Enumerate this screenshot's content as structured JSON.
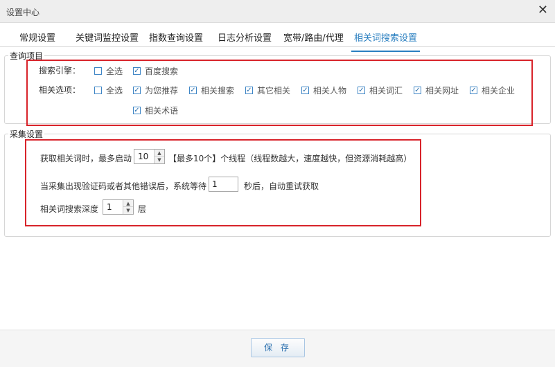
{
  "window": {
    "title": "设置中心",
    "close_icon": "close-icon"
  },
  "tabs": [
    {
      "label": "常规设置"
    },
    {
      "label": "关键词监控设置"
    },
    {
      "label": "指数查询设置"
    },
    {
      "label": "日志分析设置"
    },
    {
      "label": "宽带/路由/代理"
    },
    {
      "label": "相关词搜索设置",
      "active": true
    }
  ],
  "query_section": {
    "legend": "查询项目",
    "engine_label": "搜索引擎：",
    "engines": [
      {
        "label": "全选",
        "checked": false
      },
      {
        "label": "百度搜索",
        "checked": true
      }
    ],
    "options_label": "相关选项：",
    "options": [
      {
        "label": "全选",
        "checked": false
      },
      {
        "label": "为您推荐",
        "checked": true
      },
      {
        "label": "相关搜索",
        "checked": true
      },
      {
        "label": "其它相关",
        "checked": true
      },
      {
        "label": "相关人物",
        "checked": true
      },
      {
        "label": "相关词汇",
        "checked": true
      },
      {
        "label": "相关网址",
        "checked": true
      },
      {
        "label": "相关企业",
        "checked": true
      },
      {
        "label": "相关术语",
        "checked": true
      }
    ]
  },
  "collect_section": {
    "legend": "采集设置",
    "threads_prefix": "获取相关词时，最多启动",
    "threads_value": "10",
    "threads_suffix": "【最多10个】个线程（线程数越大，速度越快，但资源消耗越高）",
    "retry_prefix": "当采集出现验证码或者其他错误后，系统等待",
    "retry_value": "1",
    "retry_suffix": "秒后，自动重试获取",
    "depth_prefix": "相关词搜索深度",
    "depth_value": "1",
    "depth_suffix": "层"
  },
  "footer": {
    "save_label": "保 存"
  },
  "colors": {
    "accent": "#2a7fc0",
    "highlight_box": "#d8232a"
  }
}
